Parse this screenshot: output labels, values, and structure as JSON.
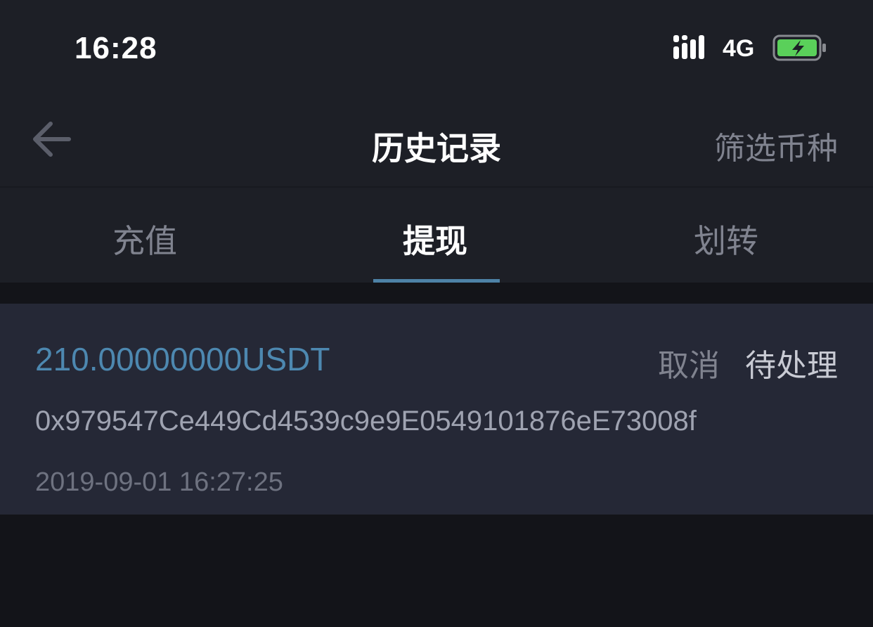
{
  "status_bar": {
    "time": "16:28",
    "network": "4G",
    "icons": [
      "signal-icon",
      "battery-icon"
    ]
  },
  "nav": {
    "title": "历史记录",
    "filter_label": "筛选币种",
    "back_icon": "back-arrow-icon"
  },
  "tabs": [
    {
      "label": "充值",
      "active": false
    },
    {
      "label": "提现",
      "active": true
    },
    {
      "label": "划转",
      "active": false
    }
  ],
  "records": [
    {
      "amount": "210.00000000USDT",
      "cancel_label": "取消",
      "status": "待处理",
      "address": "0x979547Ce449Cd4539c9e9E0549101876eE73008f",
      "time": "2019-09-01 16:27:25"
    }
  ],
  "colors": {
    "background": "#131419",
    "panel": "#1d1f26",
    "card": "#252836",
    "accent": "#4d88b0",
    "battery_fill": "#5ad05a"
  }
}
